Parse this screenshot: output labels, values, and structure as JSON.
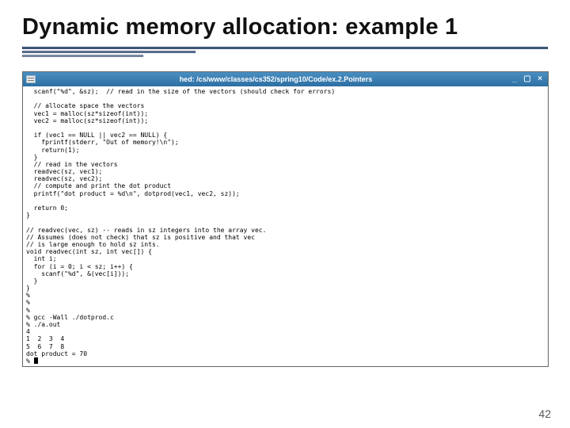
{
  "slide": {
    "title": "Dynamic memory allocation: example 1",
    "page_number": "42"
  },
  "window": {
    "titlebar": "hed: /cs/www/classes/cs352/spring10/Code/ex.2.Pointers",
    "btn_min": "_",
    "btn_max": "▢",
    "btn_close": "×",
    "code": "  scanf(\"%d\", &sz);  // read in the size of the vectors (should check for errors)\n\n  // allocate space the vectors\n  vec1 = malloc(sz*sizeof(int));\n  vec2 = malloc(sz*sizeof(int));\n\n  if (vec1 == NULL || vec2 == NULL) {\n    fprintf(stderr, \"Out of memory!\\n\");\n    return(1);\n  }\n  // read in the vectors\n  readvec(sz, vec1);\n  readvec(sz, vec2);\n  // compute and print the dot product\n  printf(\"dot product = %d\\n\", dotprod(vec1, vec2, sz));\n\n  return 0;\n}\n\n// readvec(vec, sz) -- reads in sz integers into the array vec.\n// Assumes (does not check) that sz is positive and that vec\n// is large enough to hold sz ints.\nvoid readvec(int sz, int vec[]) {\n  int i;\n  for (i = 0; i < sz; i++) {\n    scanf(\"%d\", &(vec[i]));\n  }\n}\n%\n%\n%\n% gcc -Wall ./dotprod.c\n% ./a.out\n4\n1  2  3  4\n5  6  7  8\ndot product = 70\n% "
  }
}
